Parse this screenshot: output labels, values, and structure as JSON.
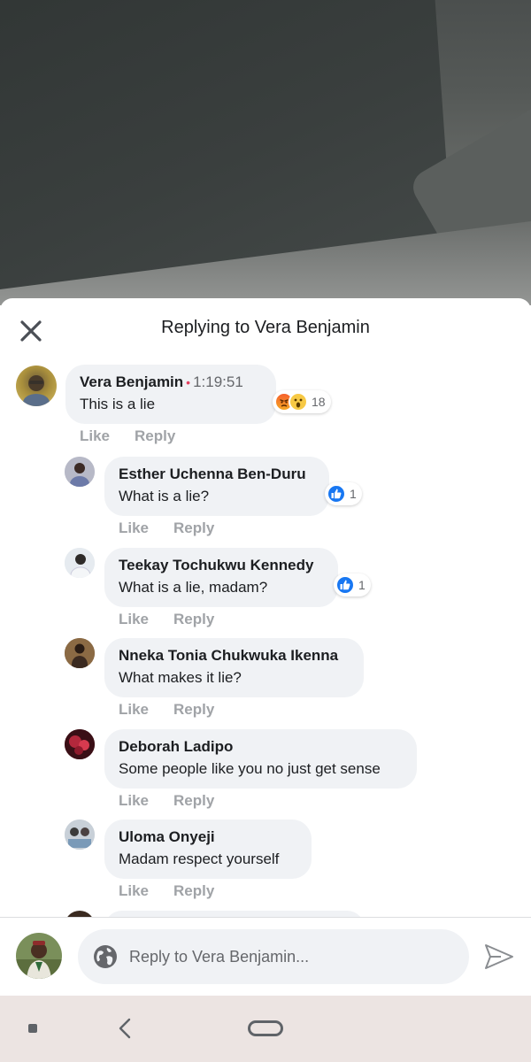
{
  "header": {
    "title": "Replying to Vera Benjamin",
    "close_icon": "close-icon"
  },
  "comments": [
    {
      "author": "Vera Benjamin",
      "timestamp": "1:19:51",
      "text": "This is a lie",
      "reactions": {
        "types": [
          "angry",
          "wow"
        ],
        "count": "18"
      },
      "like_label": "Like",
      "reply_label": "Reply"
    },
    {
      "author": "Esther Uchenna Ben-Duru",
      "text": "What is a lie?",
      "reactions": {
        "types": [
          "like"
        ],
        "count": "1"
      },
      "like_label": "Like",
      "reply_label": "Reply"
    },
    {
      "author": "Teekay Tochukwu Kennedy",
      "text": "What is a lie, madam?",
      "reactions": {
        "types": [
          "like"
        ],
        "count": "1"
      },
      "like_label": "Like",
      "reply_label": "Reply"
    },
    {
      "author": "Nneka Tonia Chukwuka Ikenna",
      "text": "What makes it lie?",
      "like_label": "Like",
      "reply_label": "Reply"
    },
    {
      "author": "Deborah Ladipo",
      "text": "Some people like you no just get sense",
      "like_label": "Like",
      "reply_label": "Reply"
    },
    {
      "author": "Uloma Onyeji",
      "text": "Madam respect yourself",
      "like_label": "Like",
      "reply_label": "Reply"
    }
  ],
  "composer": {
    "placeholder": "Reply to Vera Benjamin...",
    "globe_icon": "globe-icon",
    "send_icon": "send-icon"
  },
  "colors": {
    "bubble": "#f0f2f5",
    "like_blue": "#1877f2",
    "action_gray": "#a0a3a7",
    "nav_bg": "#ece4e2"
  }
}
